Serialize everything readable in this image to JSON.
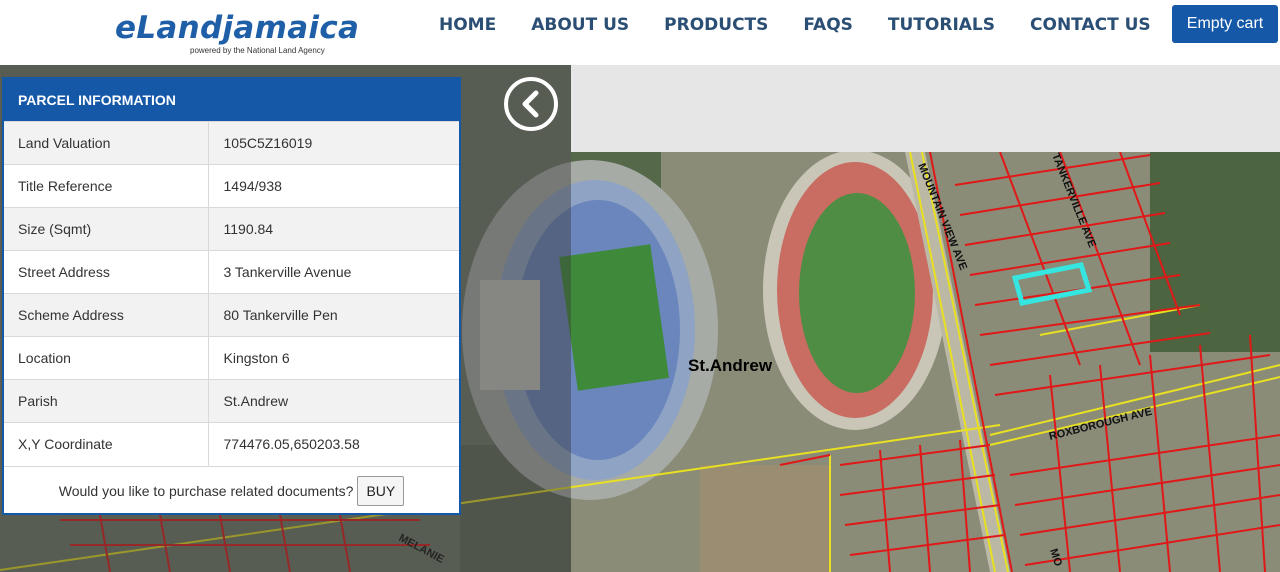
{
  "header": {
    "logo_title": "eLandjamaica",
    "logo_subtitle": "powered by the National Land Agency",
    "nav": [
      "HOME",
      "ABOUT US",
      "PRODUCTS",
      "FAQS",
      "TUTORIALS",
      "CONTACT US"
    ],
    "cart_label": "Empty cart"
  },
  "map": {
    "place_label": "St.Andrew",
    "street_labels": [
      "MOUNTAIN VIEW AVE",
      "TANKERVILLE AVE",
      "ROXBOROUGH AVE",
      "MELANIE",
      "MO"
    ],
    "highlight_color": "#35e6e0",
    "parcel_line_color": "#e01818",
    "road_line_color": "#e8e020"
  },
  "panel": {
    "title": "PARCEL INFORMATION",
    "rows": [
      {
        "label": "Land Valuation",
        "value": "105C5Z16019"
      },
      {
        "label": "Title Reference",
        "value": "1494/938"
      },
      {
        "label": "Size (Sqmt)",
        "value": "1190.84"
      },
      {
        "label": "Street Address",
        "value": "3 Tankerville Avenue"
      },
      {
        "label": "Scheme Address",
        "value": "80 Tankerville Pen"
      },
      {
        "label": "Location",
        "value": "Kingston 6"
      },
      {
        "label": "Parish",
        "value": "St.Andrew"
      },
      {
        "label": "X,Y Coordinate",
        "value": "774476.05,650203.58"
      }
    ],
    "purchase_prompt": "Would you like to purchase related documents?",
    "buy_label": "BUY"
  }
}
